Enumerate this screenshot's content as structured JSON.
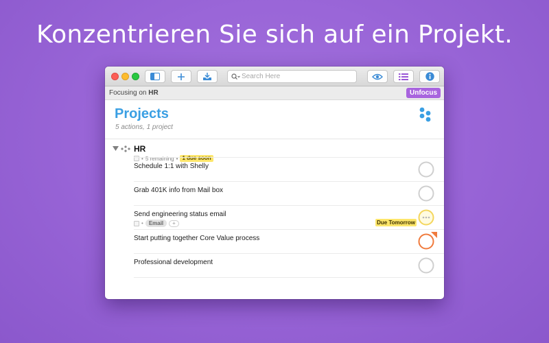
{
  "headline": "Konzentrieren Sie sich auf ein Projekt.",
  "search": {
    "placeholder": "Search Here"
  },
  "focusbar": {
    "prefix": "Focusing on",
    "project": "HR",
    "unfocus_label": "Unfocus"
  },
  "header": {
    "title": "Projects",
    "subtitle": "5 actions, 1 project"
  },
  "project": {
    "name": "HR",
    "remaining": "5 remaining",
    "due_badge": "1 due soon"
  },
  "actions": [
    {
      "title": "Schedule 1:1 with Shelly",
      "status": "normal"
    },
    {
      "title": "Grab 401K info from Mail box",
      "status": "normal"
    },
    {
      "title": "Send engineering status email",
      "status": "due-soon",
      "tag": "Email",
      "tag_add": "+",
      "due_label": "Due Tomorrow"
    },
    {
      "title": "Start putting together Core Value process",
      "status": "flagged"
    },
    {
      "title": "Professional development",
      "status": "normal"
    }
  ],
  "colors": {
    "accent_purple": "#a864de",
    "title_blue": "#3a9fe3",
    "due_yellow": "#fde66b",
    "flag_orange": "#f07a3c",
    "ring_grey": "#cfcfcf"
  },
  "icons": [
    "close-light",
    "minimize-light",
    "zoom-light",
    "sidebar-icon",
    "plus-icon",
    "inbox-icon",
    "search-icon",
    "eye-icon",
    "list-icon",
    "info-icon",
    "projects-icon",
    "disclosure-triangle-icon",
    "project-dots-icon",
    "note-icon",
    "status-ring-icon",
    "flag-icon"
  ]
}
